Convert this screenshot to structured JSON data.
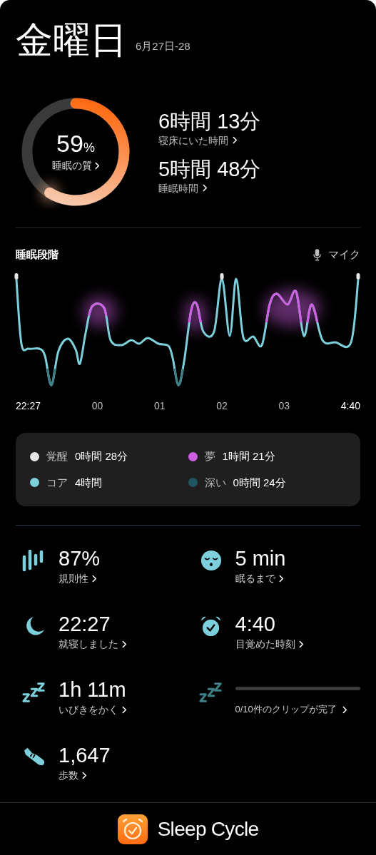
{
  "header": {
    "day": "金曜日",
    "date_range": "6月27日-28"
  },
  "quality": {
    "value": "59",
    "unit": "%",
    "label": "睡眠の質"
  },
  "durations": [
    {
      "value": "6時間 13分",
      "label": "寝床にいた時間"
    },
    {
      "value": "5時間 48分",
      "label": "睡眠時間"
    }
  ],
  "stages": {
    "title": "睡眠段階",
    "mic_label": "マイク",
    "x_labels": [
      {
        "label": "22:27",
        "kind": "end"
      },
      {
        "label": "00",
        "kind": "tick"
      },
      {
        "label": "01",
        "kind": "tick"
      },
      {
        "label": "02",
        "kind": "tick"
      },
      {
        "label": "03",
        "kind": "tick"
      },
      {
        "label": "4:40",
        "kind": "end"
      }
    ],
    "legend": [
      {
        "name": "覚醒",
        "value": "0時間 28分",
        "color": "#e6e6e6"
      },
      {
        "name": "夢",
        "value": "1時間 21分",
        "color": "#cf5fe3"
      },
      {
        "name": "コア",
        "value": "4時間",
        "color": "#7ccfdb"
      },
      {
        "name": "深い",
        "value": "0時間 24分",
        "color": "#1e5660"
      }
    ]
  },
  "stats": [
    {
      "kind": "value",
      "value": "87%",
      "label": "規則性"
    },
    {
      "kind": "value",
      "value": "5 min",
      "label": "眠るまで"
    },
    {
      "kind": "value",
      "value": "22:27",
      "label": "就寝しました"
    },
    {
      "kind": "value",
      "value": "4:40",
      "label": "目覚めた時刻"
    },
    {
      "kind": "value",
      "value": "1h 11m",
      "label": "いびきをかく"
    },
    {
      "kind": "progress",
      "label": "0/10件のクリップが完了"
    },
    {
      "kind": "value",
      "value": "1,647",
      "label": "歩数"
    }
  ],
  "footer": {
    "app_name": "Sleep Cycle"
  }
}
